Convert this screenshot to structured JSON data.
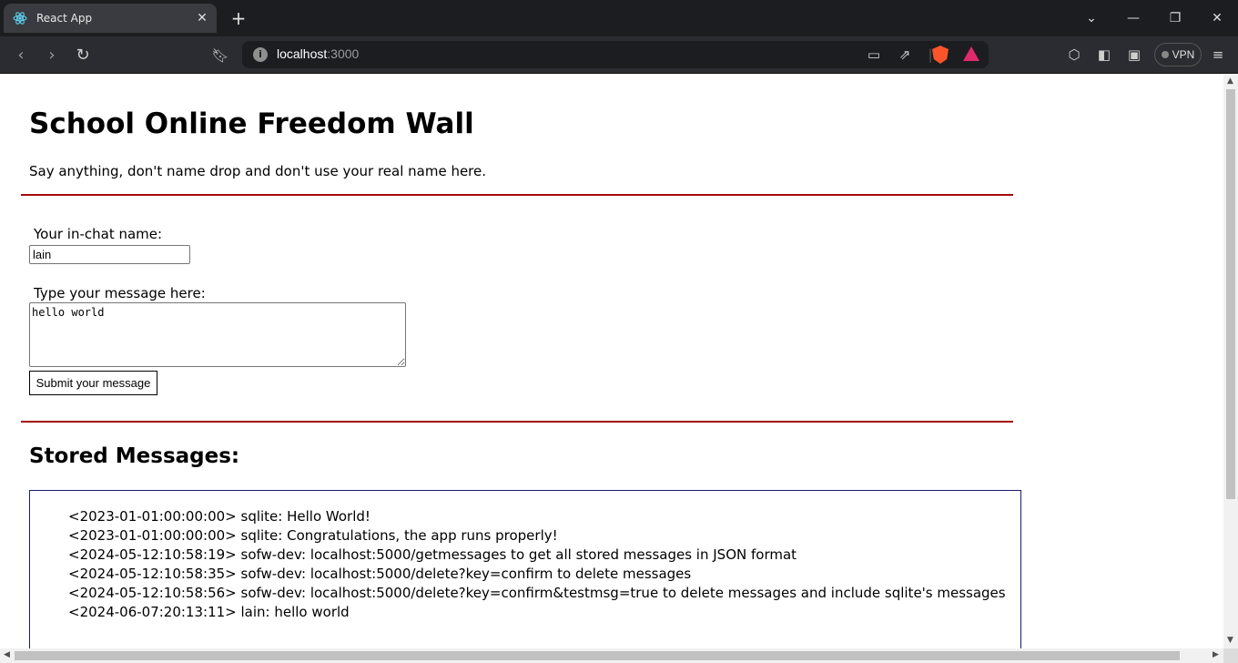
{
  "browser": {
    "tab_title": "React App",
    "url_host": "localhost",
    "url_port": ":3000",
    "vpn_label": "VPN"
  },
  "page": {
    "title": "School Online Freedom Wall",
    "subtitle": "Say anything, don't name drop and don't use your real name here.",
    "name_label": "Your in-chat name:",
    "name_value": "lain",
    "message_label": "Type your message here:",
    "message_value": "hello world",
    "submit_label": "Submit your message",
    "stored_title": "Stored Messages:"
  },
  "messages": [
    "<2023-01-01:00:00:00> sqlite: Hello World!",
    "<2023-01-01:00:00:00> sqlite: Congratulations, the app runs properly!",
    "<2024-05-12:10:58:19> sofw-dev: localhost:5000/getmessages to get all stored messages in JSON format",
    "<2024-05-12:10:58:35> sofw-dev: localhost:5000/delete?key=confirm to delete messages",
    "<2024-05-12:10:58:56> sofw-dev: localhost:5000/delete?key=confirm&testmsg=true to delete messages and include sqlite's messages",
    "<2024-06-07:20:13:11> lain: hello world"
  ],
  "colors": {
    "divider": "#a40a0a",
    "message_border": "#1a1a6e"
  }
}
